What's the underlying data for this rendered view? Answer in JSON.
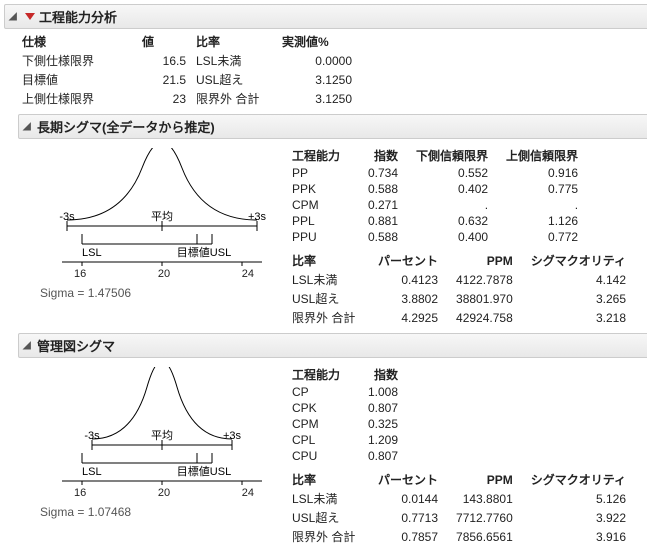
{
  "main": {
    "title": "工程能力分析",
    "spec": {
      "headers": [
        "仕様",
        "値",
        "比率",
        "実測値%"
      ],
      "rows": [
        {
          "label": "下側仕様限界",
          "value": "16.5",
          "ratio": "LSL未満",
          "obs": "0.0000"
        },
        {
          "label": "目標値",
          "value": "21.5",
          "ratio": "USL超え",
          "obs": "3.1250"
        },
        {
          "label": "上側仕様限界",
          "value": "23",
          "ratio": "限界外 合計",
          "obs": "3.1250"
        }
      ]
    }
  },
  "longterm": {
    "title": "長期シグマ(全データから推定)",
    "sigma_label": "Sigma = 1.47506",
    "chart": {
      "minus3s": "-3s",
      "mean": "平均",
      "plus3s": "+3s",
      "lsl": "LSL",
      "target_usl": "目標値USL",
      "ticks": [
        "16",
        "20",
        "24"
      ]
    },
    "cap_headers": [
      "工程能力",
      "指数",
      "下側信頼限界",
      "上側信頼限界"
    ],
    "cap_rows": [
      {
        "k": "PP",
        "idx": "0.734",
        "lcl": "0.552",
        "ucl": "0.916"
      },
      {
        "k": "PPK",
        "idx": "0.588",
        "lcl": "0.402",
        "ucl": "0.775"
      },
      {
        "k": "CPM",
        "idx": "0.271",
        "lcl": ".",
        "ucl": "."
      },
      {
        "k": "PPL",
        "idx": "0.881",
        "lcl": "0.632",
        "ucl": "1.126"
      },
      {
        "k": "PPU",
        "idx": "0.588",
        "lcl": "0.400",
        "ucl": "0.772"
      }
    ],
    "rate_headers": [
      "比率",
      "パーセント",
      "PPM",
      "シグマクオリティ"
    ],
    "rate_rows": [
      {
        "k": "LSL未満",
        "pct": "0.4123",
        "ppm": "4122.7878",
        "sq": "4.142"
      },
      {
        "k": "USL超え",
        "pct": "3.8802",
        "ppm": "38801.970",
        "sq": "3.265"
      },
      {
        "k": "限界外 合計",
        "pct": "4.2925",
        "ppm": "42924.758",
        "sq": "3.218"
      }
    ]
  },
  "control": {
    "title": "管理図シグマ",
    "sigma_label": "Sigma = 1.07468",
    "chart": {
      "minus3s": "-3s",
      "mean": "平均",
      "plus3s": "+3s",
      "lsl": "LSL",
      "target_usl": "目標値USL",
      "ticks": [
        "16",
        "20",
        "24"
      ]
    },
    "cap_headers": [
      "工程能力",
      "指数"
    ],
    "cap_rows": [
      {
        "k": "CP",
        "idx": "1.008"
      },
      {
        "k": "CPK",
        "idx": "0.807"
      },
      {
        "k": "CPM",
        "idx": "0.325"
      },
      {
        "k": "CPL",
        "idx": "1.209"
      },
      {
        "k": "CPU",
        "idx": "0.807"
      }
    ],
    "rate_headers": [
      "比率",
      "パーセント",
      "PPM",
      "シグマクオリティ"
    ],
    "rate_rows": [
      {
        "k": "LSL未満",
        "pct": "0.0144",
        "ppm": "143.8801",
        "sq": "5.126"
      },
      {
        "k": "USL超え",
        "pct": "0.7713",
        "ppm": "7712.7760",
        "sq": "3.922"
      },
      {
        "k": "限界外 合計",
        "pct": "0.7857",
        "ppm": "7856.6561",
        "sq": "3.916"
      }
    ]
  },
  "chart_data": [
    {
      "type": "distribution",
      "title": "長期シグマ(全データから推定)",
      "mean": 20.4,
      "sigma": 1.47506,
      "lsl": 16.5,
      "usl": 23,
      "target": 21.5,
      "minus3s": 15.97,
      "plus3s": 24.83,
      "x_ticks": [
        16,
        20,
        24
      ]
    },
    {
      "type": "distribution",
      "title": "管理図シグマ",
      "mean": 20.4,
      "sigma": 1.07468,
      "lsl": 16.5,
      "usl": 23,
      "target": 21.5,
      "minus3s": 17.18,
      "plus3s": 23.62,
      "x_ticks": [
        16,
        20,
        24
      ]
    }
  ]
}
